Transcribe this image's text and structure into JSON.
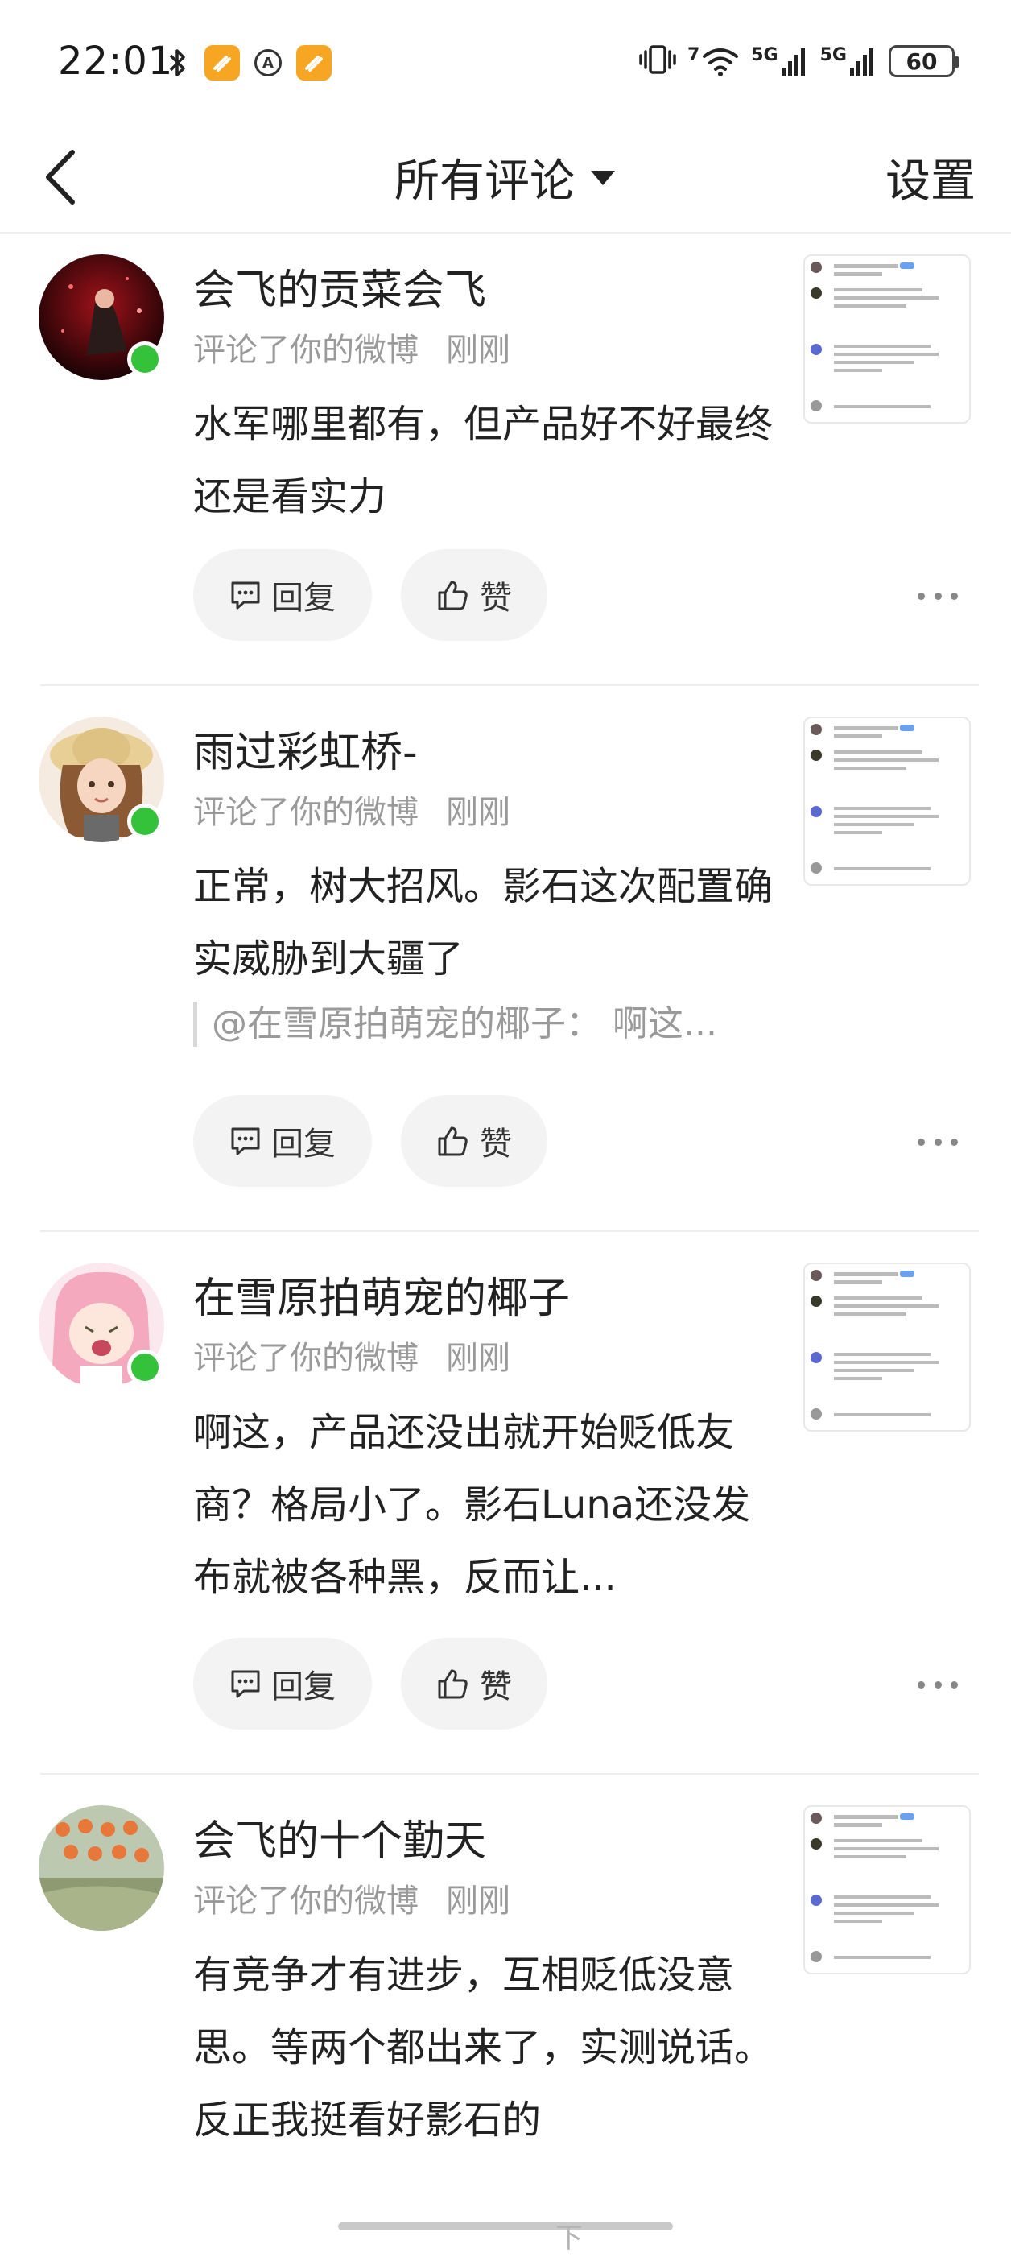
{
  "status_bar": {
    "time": "22:01",
    "battery": "60",
    "signal1_label": "5G",
    "signal2_label": "5G",
    "wifi_label": "7"
  },
  "nav": {
    "title": "所有评论",
    "settings_label": "设置"
  },
  "comments": [
    {
      "user": "会飞的贡菜会飞",
      "action": "评论了你的微博",
      "time": "刚刚",
      "text": "水军哪里都有，但产品好不好最终还是看实力",
      "quote": "",
      "reply_label": "回复",
      "like_label": "赞"
    },
    {
      "user": "雨过彩虹桥-",
      "action": "评论了你的微博",
      "time": "刚刚",
      "text": "正常，树大招风。影石这次配置确实威胁到大疆了",
      "quote": "@在雪原拍萌宠的椰子： 啊这...",
      "reply_label": "回复",
      "like_label": "赞"
    },
    {
      "user": "在雪原拍萌宠的椰子",
      "action": "评论了你的微博",
      "time": "刚刚",
      "text": "啊这，产品还没出就开始贬低友商？格局小了。影石Luna还没发布就被各种黑，反而让...",
      "quote": "",
      "reply_label": "回复",
      "like_label": "赞"
    },
    {
      "user": "会飞的十个勤天",
      "action": "评论了你的微博",
      "time": "刚刚",
      "text": "有竞争才有进步，互相贬低没意思。等两个都出来了，实测说话。反正我挺看好影石的",
      "quote": "",
      "reply_label": "回复",
      "like_label": "赞"
    }
  ],
  "bottom_hint": "下",
  "colors": {
    "online": "#35c23b",
    "meta": "#9a9a9a",
    "pill_bg": "#f3f3f3",
    "badge": "#f6a623"
  }
}
